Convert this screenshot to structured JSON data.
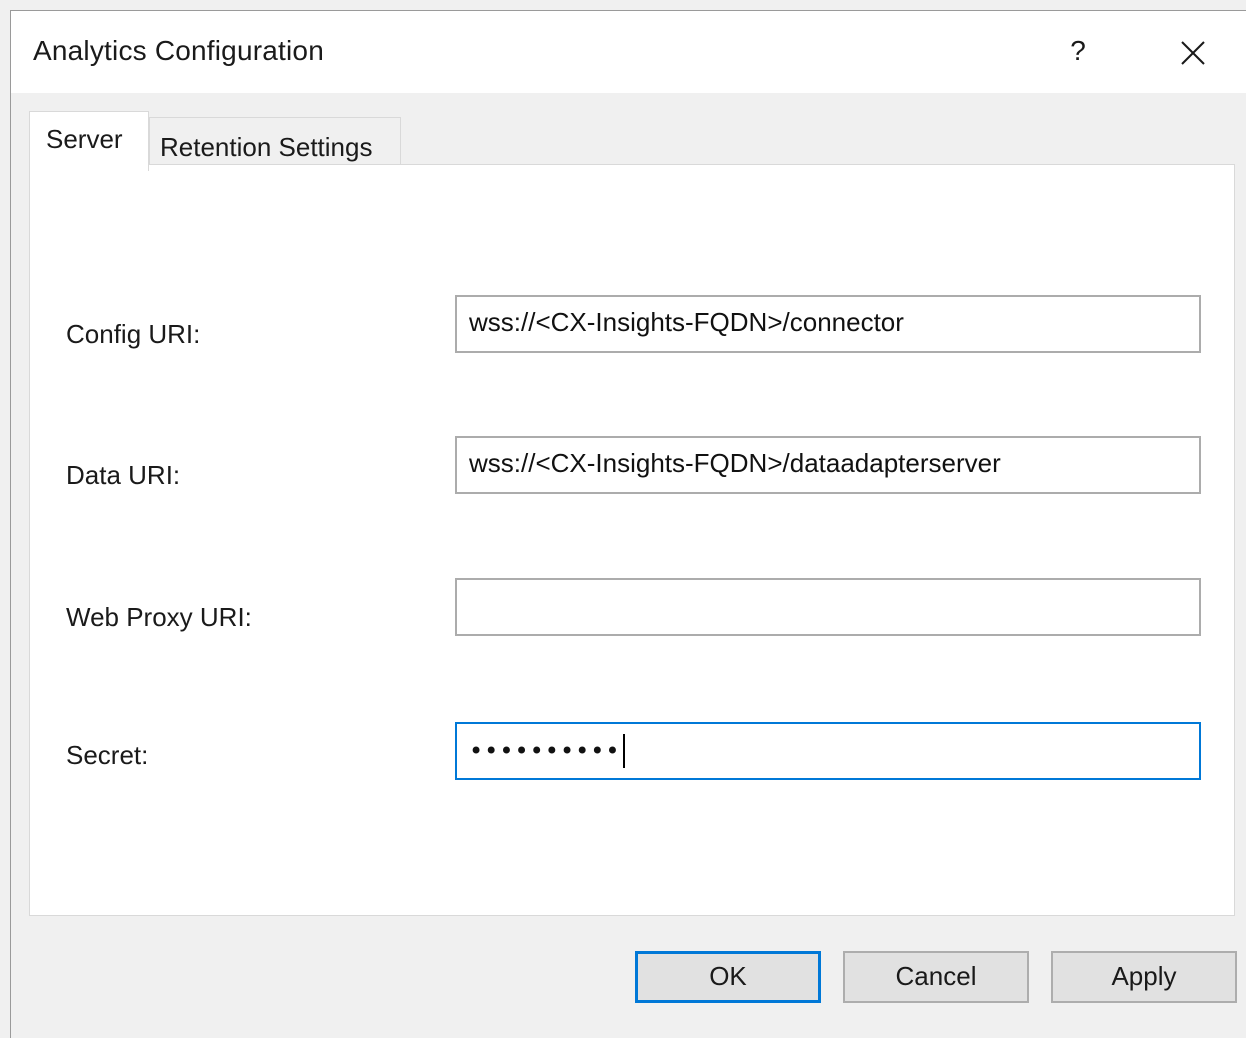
{
  "window": {
    "title": "Analytics Configuration",
    "help_label": "?"
  },
  "tabs": [
    {
      "label": "Server",
      "active": true
    },
    {
      "label": "Retention Settings",
      "active": false
    }
  ],
  "fields": {
    "config_uri": {
      "label": "Config URI:",
      "value": "wss://<CX-Insights-FQDN>/connector"
    },
    "data_uri": {
      "label": "Data URI:",
      "value": "wss://<CX-Insights-FQDN>/dataadapterserver"
    },
    "web_proxy_uri": {
      "label": "Web Proxy URI:",
      "value": ""
    },
    "secret": {
      "label": "Secret:",
      "value": "••••••••••"
    }
  },
  "buttons": {
    "ok": "OK",
    "cancel": "Cancel",
    "apply": "Apply"
  },
  "colors": {
    "focus_accent": "#0078d7",
    "dialog_background": "#f0f0f0"
  },
  "icons": {
    "close": "close-icon"
  }
}
